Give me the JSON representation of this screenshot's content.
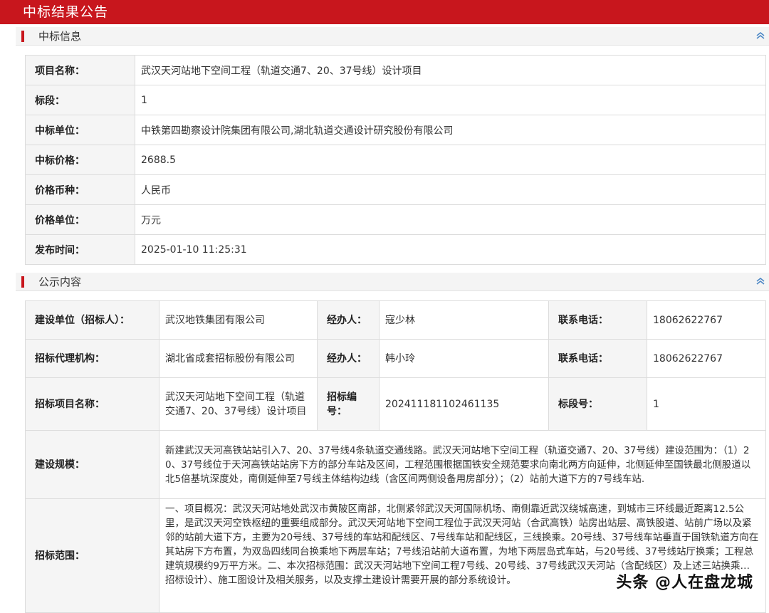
{
  "page_title": "中标结果公告",
  "section1": {
    "title": "中标信息",
    "rows": [
      {
        "label": "项目名称：",
        "value": "武汉天河站地下空间工程（轨道交通7、20、37号线）设计项目"
      },
      {
        "label": "标段：",
        "value": "1"
      },
      {
        "label": "中标单位：",
        "value": "中铁第四勘察设计院集团有限公司,湖北轨道交通设计研究股份有限公司"
      },
      {
        "label": "中标价格：",
        "value": "2688.5"
      },
      {
        "label": "价格币种：",
        "value": "人民币"
      },
      {
        "label": "价格单位：",
        "value": "万元"
      },
      {
        "label": "发布时间：",
        "value": "2025-01-10 11:25:31"
      }
    ]
  },
  "section2": {
    "title": "公示内容",
    "row1": {
      "l1": "建设单位（招标人）：",
      "v1": "武汉地铁集团有限公司",
      "l2": "经办人：",
      "v2": "寇少林",
      "l3": "联系电话：",
      "v3": "18062622767"
    },
    "row2": {
      "l1": "招标代理机构：",
      "v1": "湖北省成套招标股份有限公司",
      "l2": "经办人：",
      "v2": "韩小玲",
      "l3": "联系电话：",
      "v3": "18062622767"
    },
    "row3": {
      "l1": "招标项目名称：",
      "v1": "武汉天河站地下空间工程（轨道交通7、20、37号线）设计项目",
      "l2": "招标编号：",
      "v2": "202411181102461135",
      "l3": "标段号：",
      "v3": "1"
    },
    "scale": {
      "label": "建设规模：",
      "value": "新建武汉天河高铁站站引入7、20、37号线4条轨道交通线路。武汉天河站地下空间工程（轨道交通7、20、37号线）建设范围为：（1）20、37号线位于天河高铁站站房下方的部分车站及区间，工程范围根据国铁安全规范要求向南北两方向延伸，北侧延伸至国铁最北侧股道以北5倍基坑深度处，南侧延伸至7号线主体结构边线（含区间两侧设备用房部分）；（2）站前大道下方的7号线车站."
    },
    "scope": {
      "label": "招标范围：",
      "value": "一、项目概况：武汉天河站地处武汉市黄陂区南部，北侧紧邻武汉天河国际机场、南侧靠近武汉绕城高速，到城市三环线最近距离12.5公里，是武汉天河空铁枢纽的重要组成部分。武汉天河站地下空间工程位于武汉天河站（合武高铁）站房出站层、高铁股道、站前广场以及紧邻的站前大道下方，主要为20号线、37号线的车站和配线区、7号线车站和配线区，三线换乘。20号线、37号线车站垂直于国铁轨道方向在其站房下方布置，为双岛四线同台换乘地下两层车站；7号线沿站前大道布置，为地下两层岛式车站，与20号线、37号线站厅换乘；工程总建筑规模约9万平方米。二、本次招标范围：武汉天河站地下空间工程7号线、20号线、37号线武汉天河站（含配线区）及上述三站换乘… 招标设计）、施工图设计及相关服务，以及支撑土建设计需要开展的部分系统设计。"
    }
  },
  "watermark": "头条 @人在盘龙城"
}
